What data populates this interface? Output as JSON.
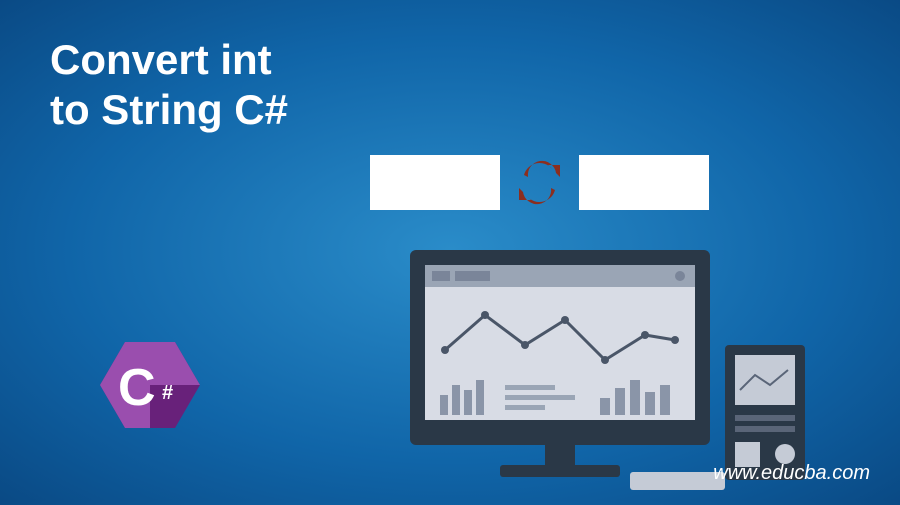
{
  "title": {
    "line1": "Convert int",
    "line2": "to String C#"
  },
  "logo": {
    "letter": "C",
    "symbol": "#"
  },
  "url": "www.educba.com",
  "colors": {
    "bg_center": "#2a8cc9",
    "bg_outer": "#0a4a85",
    "logo_dark": "#68217a",
    "logo_light": "#9a4eae",
    "sync_arrow": "#8b2e1f",
    "monitor_frame": "#2a3847",
    "screen_bg": "#d8dce5"
  }
}
